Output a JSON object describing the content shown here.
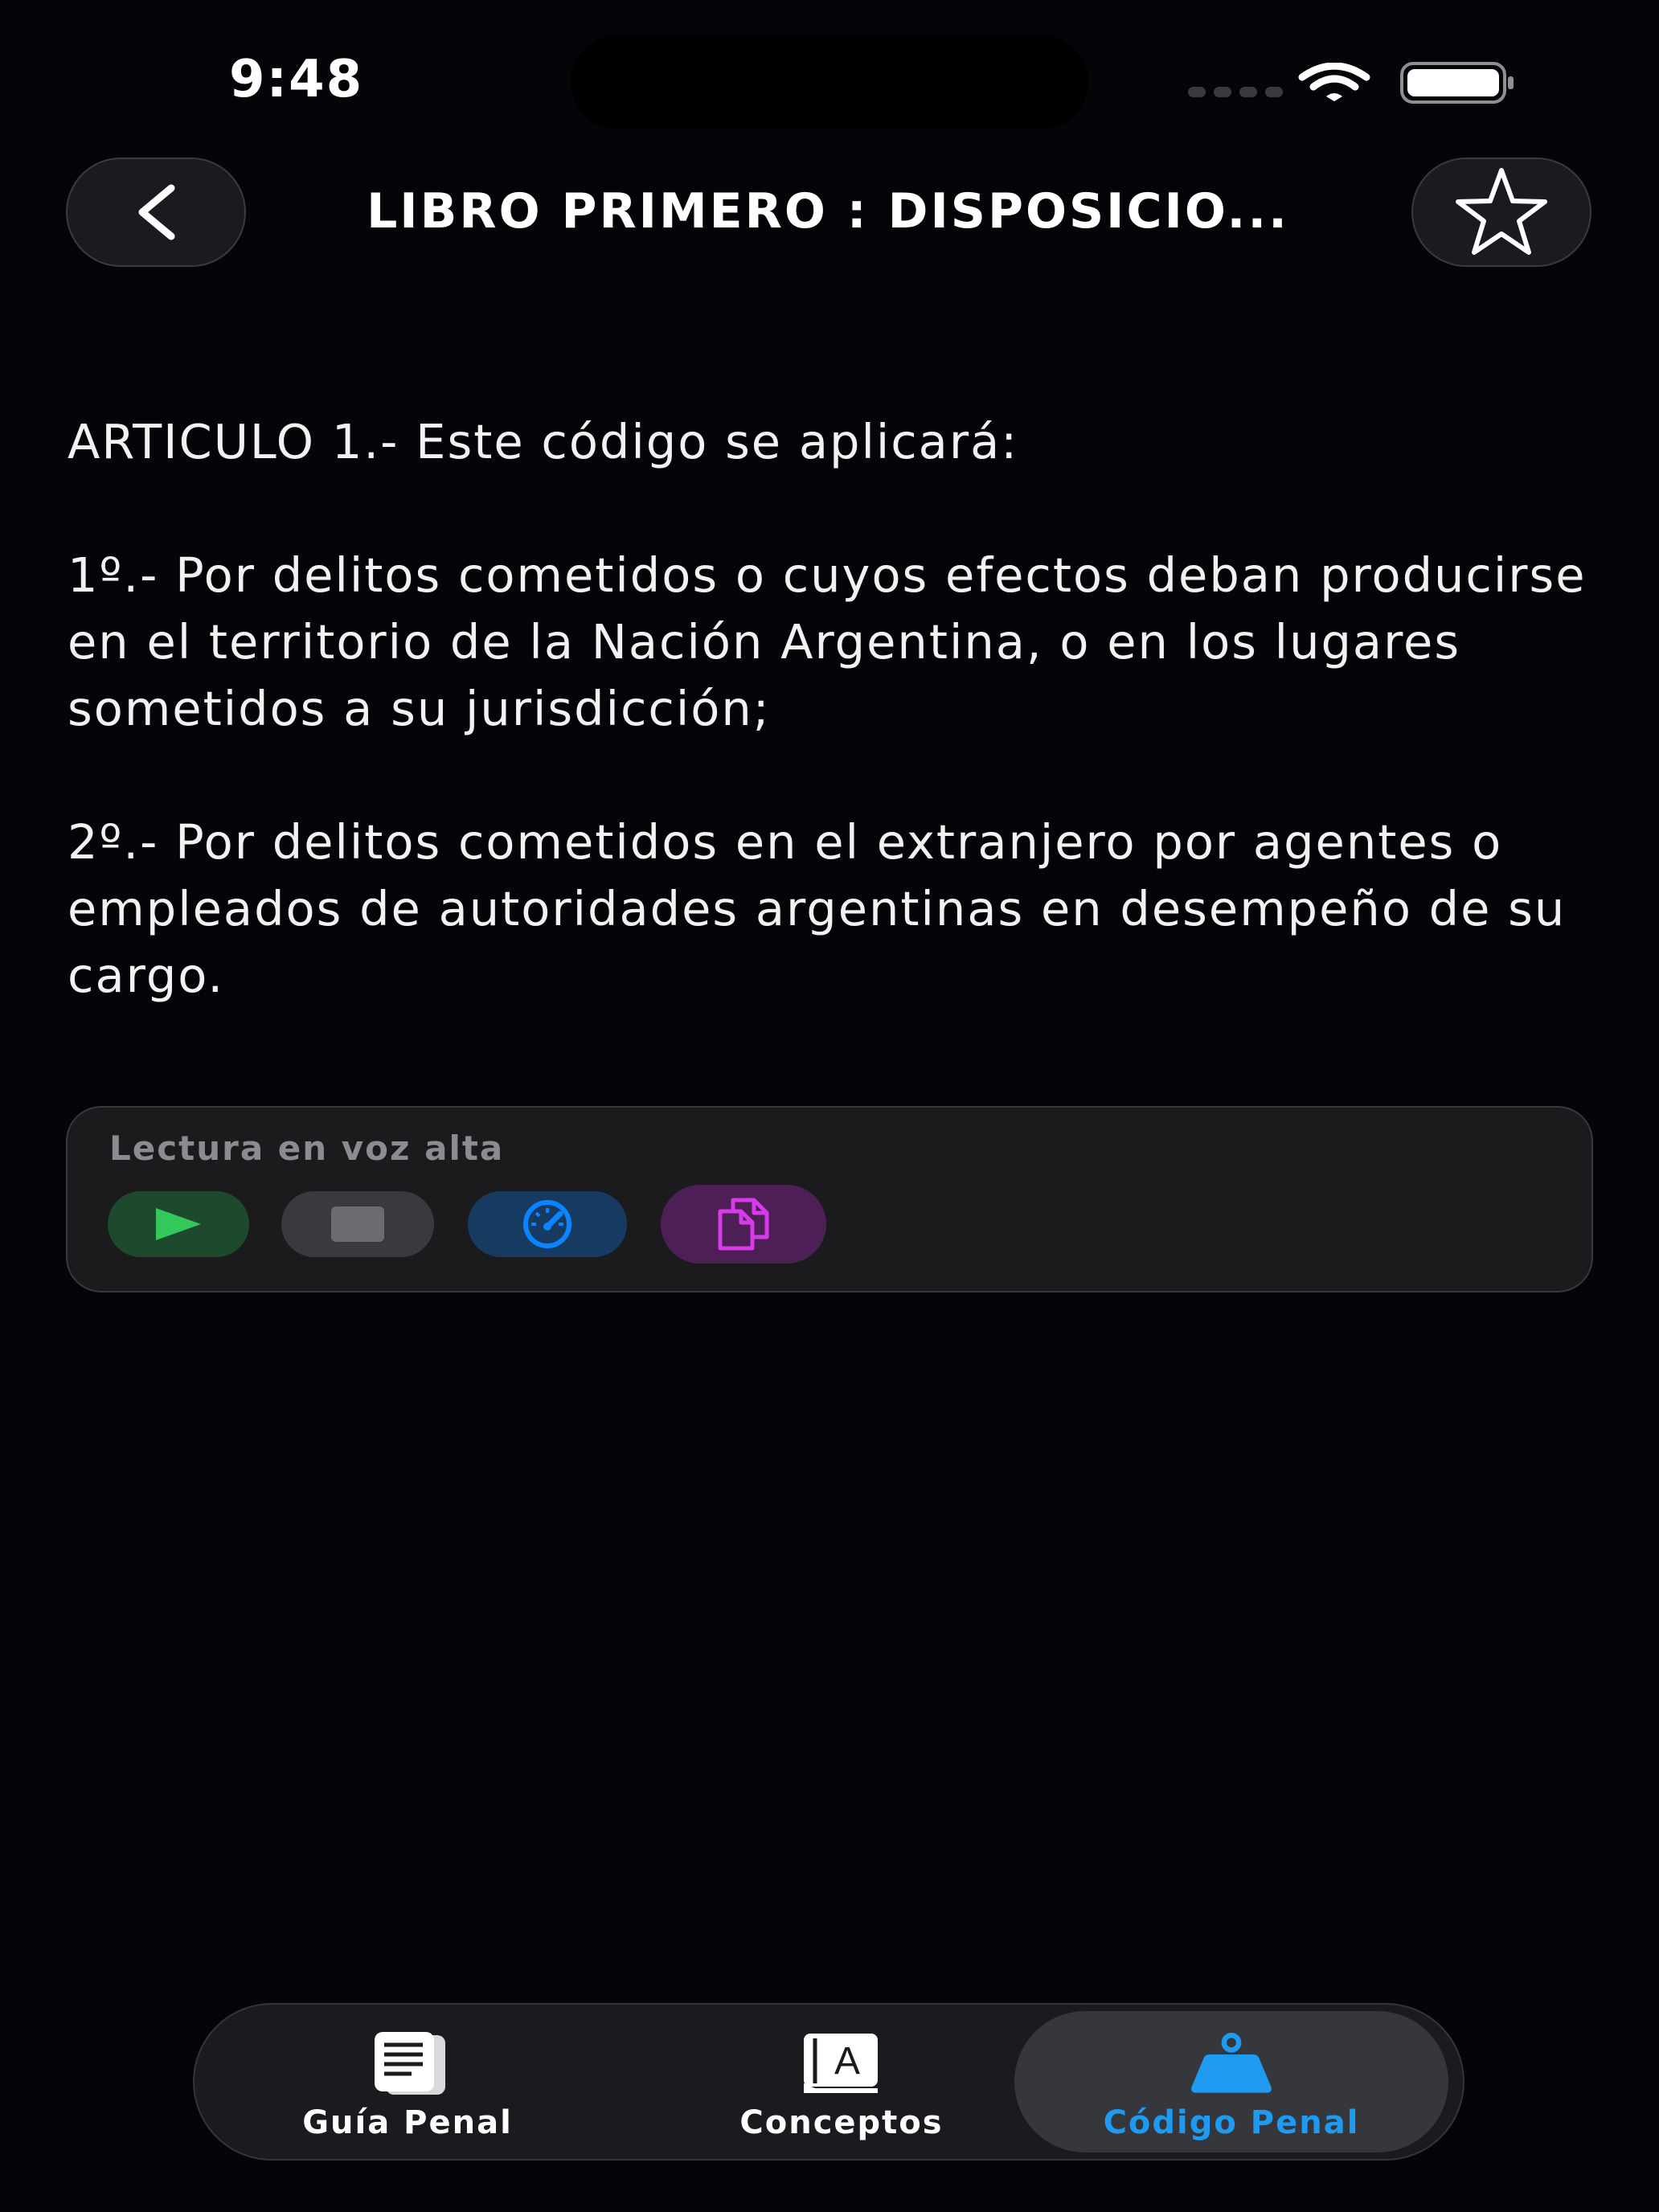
{
  "status_bar": {
    "time": "9:48"
  },
  "nav": {
    "title": "LIBRO PRIMERO : DISPOSICIO...",
    "back_icon": "chevron-left-icon",
    "favorite_icon": "star-outline-icon"
  },
  "article": {
    "heading": "ARTICULO 1.- Este código se aplicará:",
    "paragraph_1": "1º.- Por delitos cometidos o cuyos efectos deban producirse en el territorio de la Nación Argentina, o en los lugares sometidos a su jurisdicción;",
    "paragraph_2": "2º.- Por delitos cometidos en el extranjero por agentes o empleados de autoridades argentinas en desempeño de su cargo."
  },
  "tts": {
    "title": "Lectura en voz alta",
    "buttons": [
      {
        "icon": "play-icon",
        "color": "#34c759"
      },
      {
        "icon": "stop-icon",
        "color": "#6b6b70"
      },
      {
        "icon": "speedometer-icon",
        "color": "#0a84ff"
      },
      {
        "icon": "copy-icon",
        "color": "#d63ce6"
      }
    ]
  },
  "tabs": [
    {
      "label": "Guía Penal",
      "icon": "document-icon",
      "selected": false
    },
    {
      "label": "Conceptos",
      "icon": "dictionary-icon",
      "selected": false
    },
    {
      "label": "Código Penal",
      "icon": "weight-icon",
      "selected": true
    }
  ],
  "colors": {
    "background": "#050509",
    "accent": "#1e9bf0"
  }
}
